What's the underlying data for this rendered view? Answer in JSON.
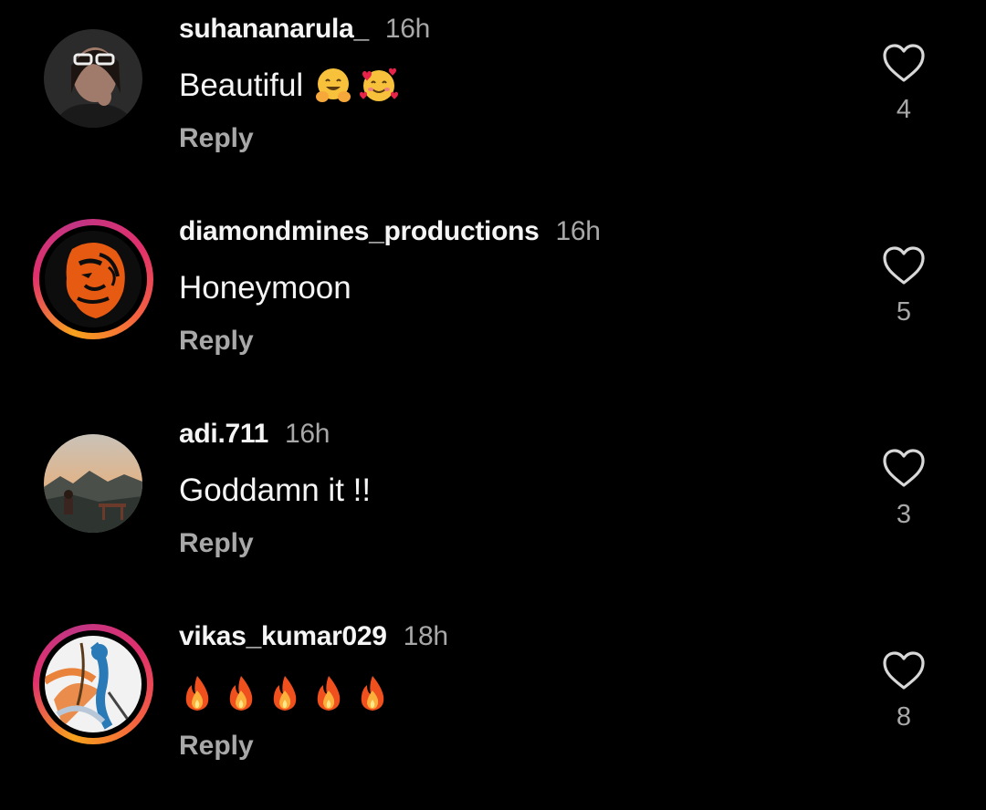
{
  "comments": [
    {
      "username": "suhananarula_",
      "time": "16h",
      "text": "Beautiful",
      "emojis": [
        "hugging-face-icon",
        "smiling-face-with-hearts-icon"
      ],
      "reply_label": "Reply",
      "likes": "4",
      "has_story_ring": false
    },
    {
      "username": "diamondmines_productions",
      "time": "16h",
      "text": "Honeymoon",
      "emojis": [],
      "reply_label": "Reply",
      "likes": "5",
      "has_story_ring": true
    },
    {
      "username": "adi.711",
      "time": "16h",
      "text": "Goddamn it !!",
      "emojis": [],
      "reply_label": "Reply",
      "likes": "3",
      "has_story_ring": false
    },
    {
      "username": "vikas_kumar029",
      "time": "18h",
      "text": "",
      "emojis": [
        "fire-icon",
        "fire-icon",
        "fire-icon",
        "fire-icon",
        "fire-icon"
      ],
      "reply_label": "Reply",
      "likes": "8",
      "has_story_ring": true
    }
  ],
  "colors": {
    "background": "#000000",
    "primary_text": "#f5f5f5",
    "secondary_text": "#a8a8a8",
    "story_ring_start": "#f7a21c",
    "story_ring_end": "#c13584"
  }
}
